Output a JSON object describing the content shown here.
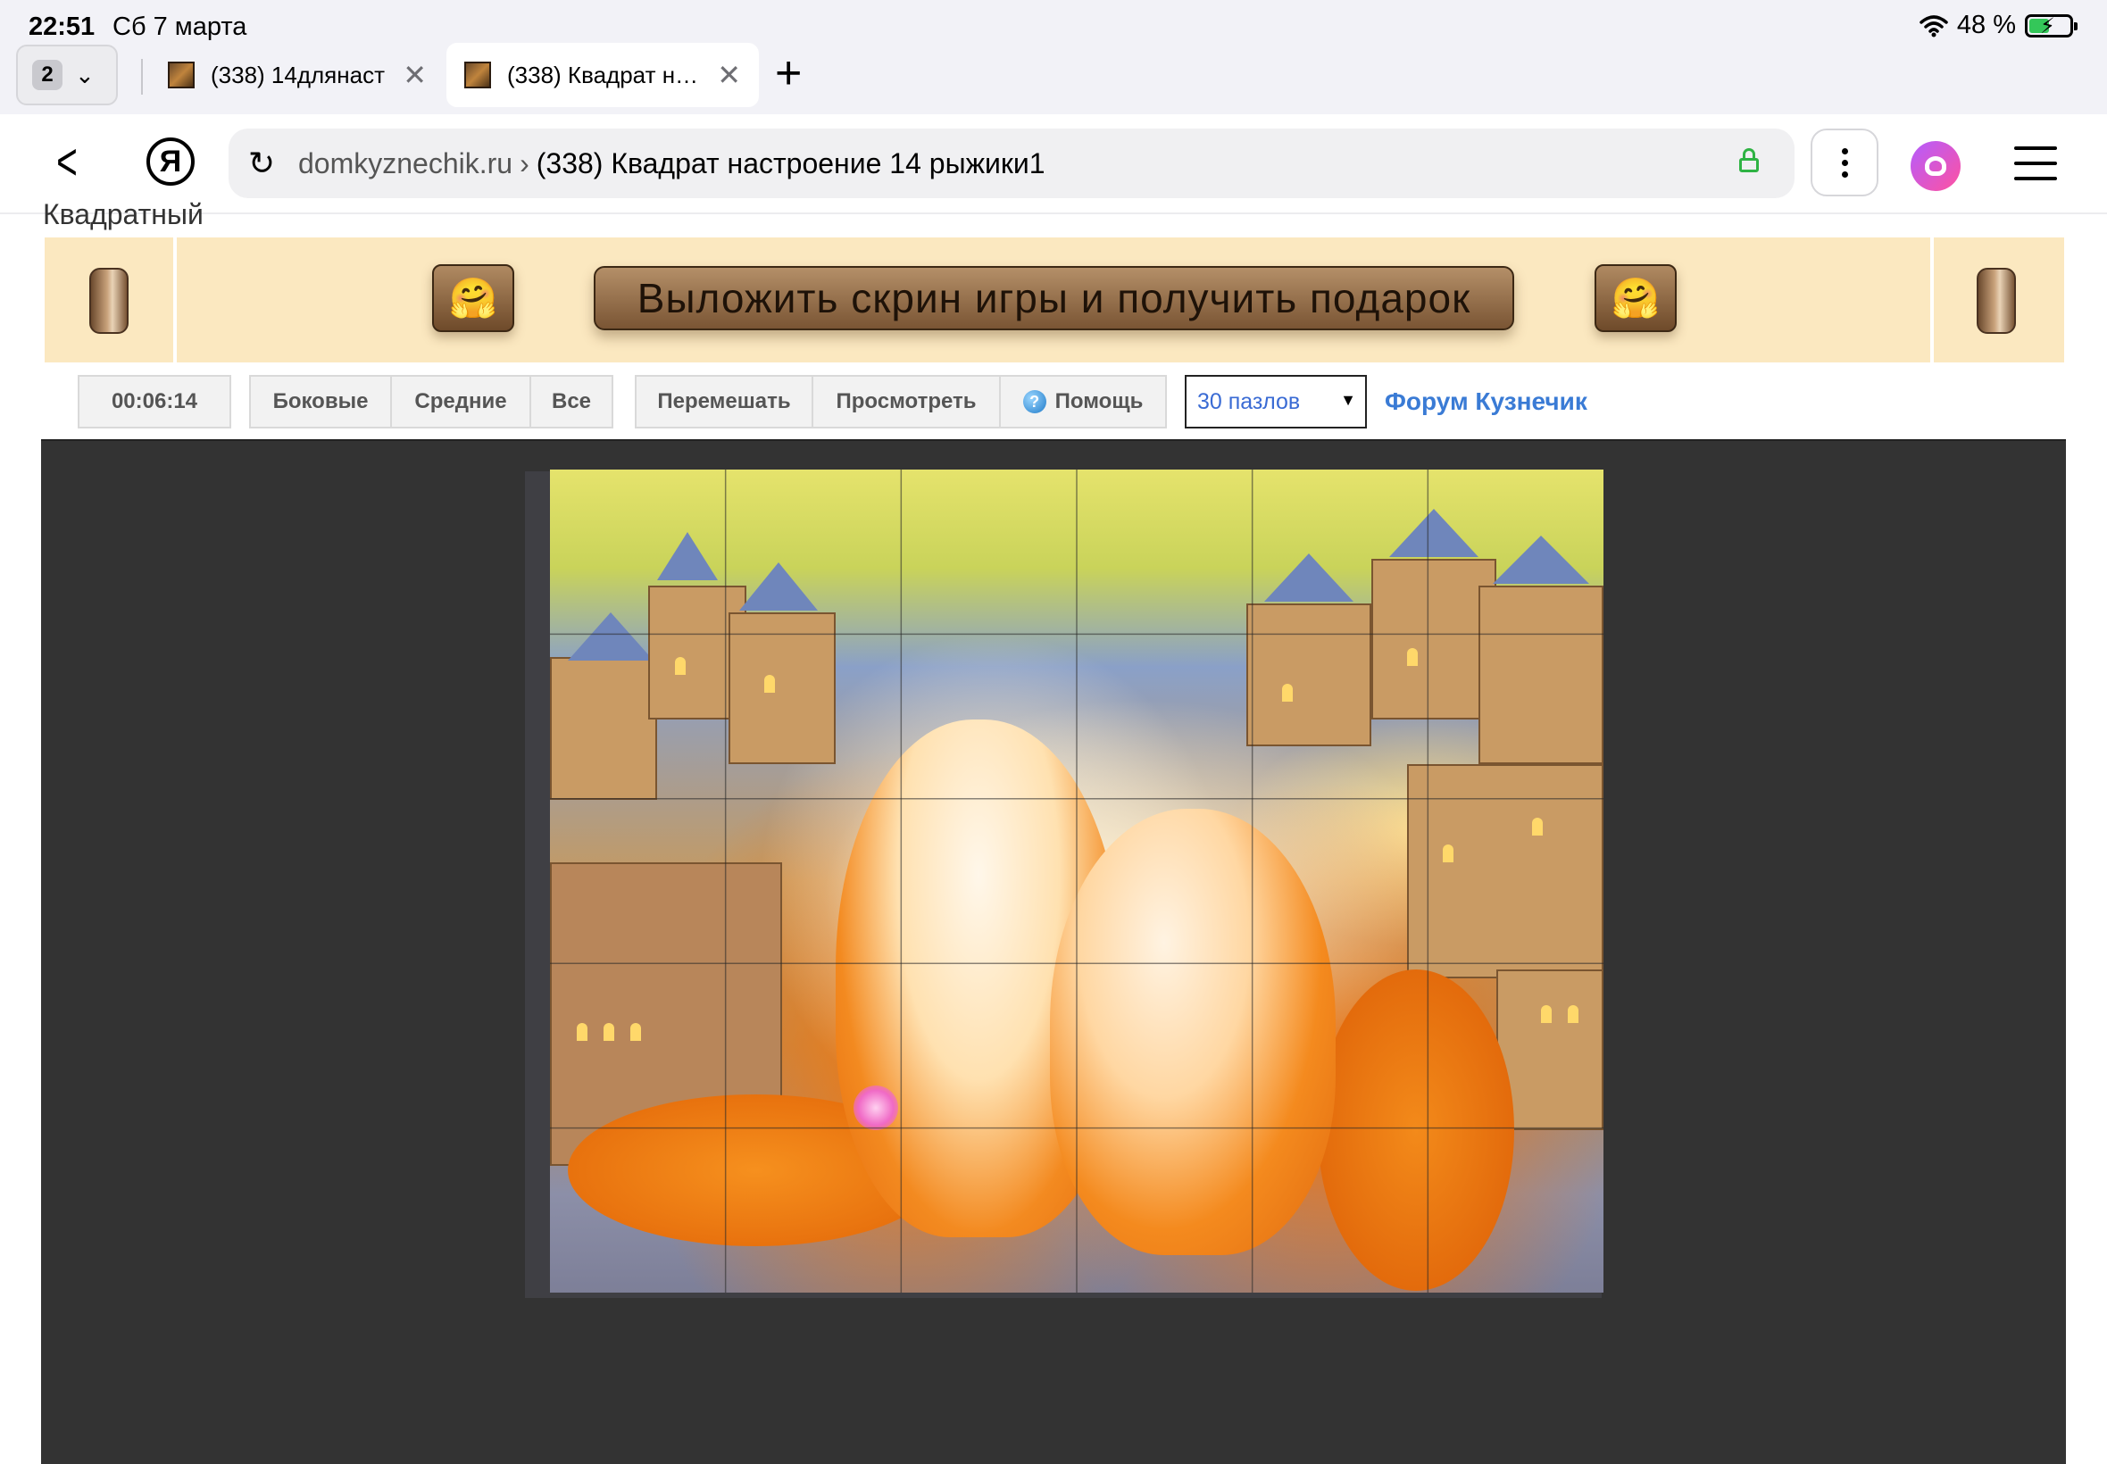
{
  "status_bar": {
    "time": "22:51",
    "date": "Сб 7 марта",
    "battery_text": "48 %",
    "battery_level": 0.48
  },
  "tabs": {
    "count": "2",
    "items": [
      {
        "title": "(338) 14длянаст…"
      },
      {
        "title": "(338) Квадрат н…"
      }
    ]
  },
  "omnibox": {
    "domain": "domkyznechik.ru",
    "separator": "›",
    "page_title": "(338) Квадрат настроение 14 рыжики1",
    "icons": [
      "back-icon",
      "yandex-icon",
      "reload-icon",
      "lock-icon",
      "more-icon",
      "alice-icon",
      "menu-icon"
    ]
  },
  "page": {
    "heading": "Квадратный",
    "banner": {
      "cta": "Выложить скрин игры и получить подарок",
      "emoji": "🤗"
    },
    "toolbar": {
      "timer": "00:06:14",
      "edge_pieces": "Боковые",
      "middle_pieces": "Средние",
      "all_pieces": "Все",
      "shuffle": "Перемешать",
      "preview": "Просмотреть",
      "help": "Помощь",
      "pieces_select": "30 пазлов",
      "forum_link": "Форум Кузнечик"
    },
    "puzzle": {
      "columns": 6,
      "rows": 5
    }
  },
  "colors": {
    "banner_bg": "#fbe8c0",
    "game_bg": "#333333",
    "link": "#3a7bd5",
    "secure": "#2fb344"
  }
}
